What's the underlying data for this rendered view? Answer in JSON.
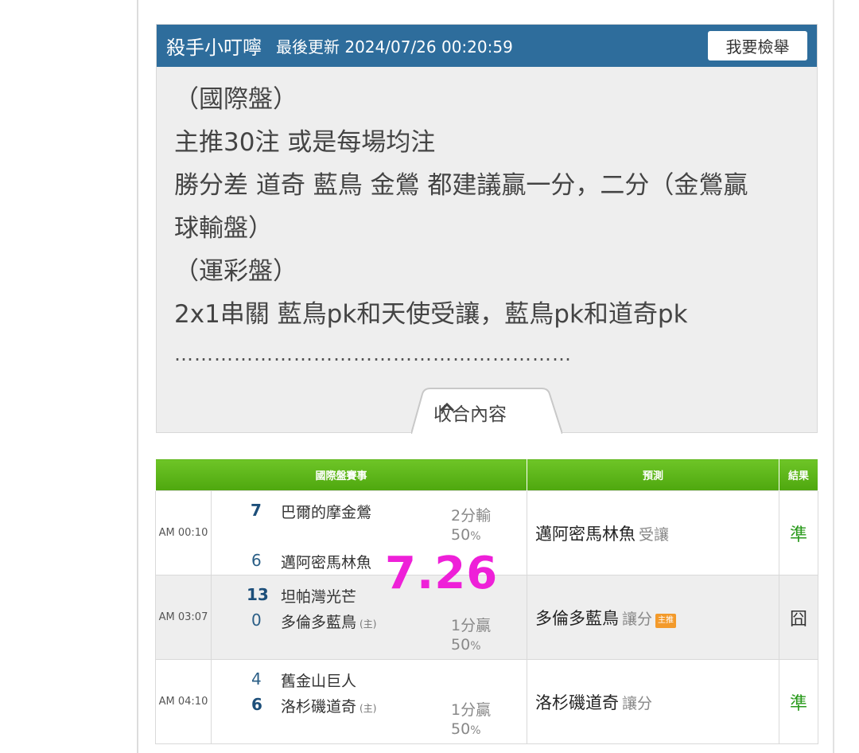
{
  "post": {
    "author": "殺手小叮嚀",
    "updated": "最後更新 2024/07/26 00:20:59",
    "report_button": "我要檢舉",
    "lines": [
      "（國際盤）",
      "主推30注 或是每場均注",
      "勝分差 道奇 藍鳥 金鶯 都建議贏一分，二分（金鶯贏",
      "球輸盤）",
      "（運彩盤）",
      "2x1串關 藍鳥pk和天使受讓，藍鳥pk和道奇pk"
    ],
    "dots": "……………………………………………………",
    "collapse_label": "收合內容"
  },
  "table": {
    "headers": {
      "match": "國際盤賽事",
      "prediction": "預測",
      "result": "結果"
    },
    "rows": [
      {
        "time": "AM 00:10",
        "team1_score": "7",
        "team1_name": "巴爾的摩金鶯",
        "team1_home": "",
        "team2_score": "6",
        "team2_name": "邁阿密馬林魚",
        "team2_home": "",
        "spread": "2分輸",
        "pct": "50",
        "pct_unit": "%",
        "prediction": "邁阿密馬林魚",
        "pred_tag": "受讓",
        "main_pick": "",
        "result": "準",
        "result_color": "#2a9a1c"
      },
      {
        "time": "AM 03:07",
        "team1_score": "13",
        "team1_name": "坦帕灣光芒",
        "team1_home": "",
        "team2_score": "0",
        "team2_name": "多倫多藍鳥",
        "team2_home": "(主)",
        "spread": "1分贏",
        "pct": "50",
        "pct_unit": "%",
        "prediction": "多倫多藍鳥",
        "pred_tag": "讓分",
        "main_pick": "主推",
        "result": "囧",
        "result_color": "#333333"
      },
      {
        "time": "AM 04:10",
        "team1_score": "4",
        "team1_name": "舊金山巨人",
        "team1_home": "",
        "team2_score": "6",
        "team2_name": "洛杉磯道奇",
        "team2_home": "(主)",
        "spread": "1分贏",
        "pct": "50",
        "pct_unit": "%",
        "prediction": "洛杉磯道奇",
        "pred_tag": "讓分",
        "main_pick": "",
        "result": "準",
        "result_color": "#2a9a1c"
      }
    ]
  },
  "stamp": "7.26",
  "colors": {
    "header_bg": "#2e6d9c",
    "table_header": "#5cb51a",
    "stamp": "#ee20d8"
  }
}
